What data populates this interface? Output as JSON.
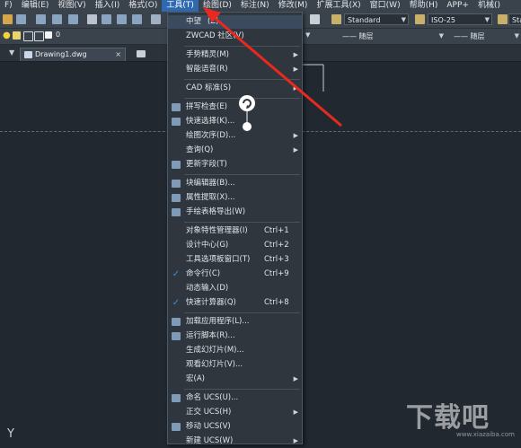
{
  "menubar": [
    "F)",
    "编辑(E)",
    "视图(V)",
    "插入(I)",
    "格式(O)",
    "工具(T)",
    "绘图(D)",
    "标注(N)",
    "修改(M)",
    "扩展工具(X)",
    "窗口(W)",
    "帮助(H)",
    "APP+",
    "机械()"
  ],
  "toolbar": {
    "text_style": "Standard",
    "dim_style": "ISO-25",
    "dim_style_extra": "Sta",
    "layer": "0",
    "linetype1": "—— 随层",
    "linetype2": "—— 随层"
  },
  "tab": {
    "label": "Drawing1.dwg"
  },
  "menu": {
    "items": [
      {
        "label": "中望",
        "suffix": "(Z)",
        "icon": "none",
        "shortcut": "",
        "submenu": false
      },
      {
        "label": "ZWCAD 社区(V)",
        "icon": "none",
        "shortcut": "",
        "submenu": false
      },
      {
        "label": "手势精灵(M)",
        "icon": "none",
        "shortcut": "",
        "submenu": true
      },
      {
        "label": "智能语音(R)",
        "icon": "none",
        "shortcut": "",
        "submenu": true
      },
      {
        "label": "CAD 标准(S)",
        "icon": "none",
        "shortcut": "",
        "submenu": true
      },
      {
        "label": "拼写检查(E)",
        "icon": "spell-icon",
        "shortcut": "",
        "submenu": false
      },
      {
        "label": "快速选择(K)...",
        "icon": "quickselect-icon",
        "shortcut": "",
        "submenu": false
      },
      {
        "label": "绘图次序(D)...",
        "icon": "none",
        "shortcut": "",
        "submenu": true
      },
      {
        "label": "查询(Q)",
        "icon": "none",
        "shortcut": "",
        "submenu": true
      },
      {
        "label": "更新字段(T)",
        "icon": "update-field-icon",
        "shortcut": "",
        "submenu": false
      },
      {
        "label": "块编辑器(B)...",
        "icon": "block-editor-icon",
        "shortcut": "",
        "submenu": false
      },
      {
        "label": "属性提取(X)...",
        "icon": "attribute-icon",
        "shortcut": "",
        "submenu": false
      },
      {
        "label": "手绘表格导出(W)",
        "icon": "table-export-icon",
        "shortcut": "",
        "submenu": false
      },
      {
        "label": "对象特性管理器(I)",
        "icon": "none",
        "shortcut": "Ctrl+1",
        "submenu": false
      },
      {
        "label": "设计中心(G)",
        "icon": "none",
        "shortcut": "Ctrl+2",
        "submenu": false
      },
      {
        "label": "工具选项板窗口(T)",
        "icon": "none",
        "shortcut": "Ctrl+3",
        "submenu": false
      },
      {
        "label": "命令行(C)",
        "icon": "check-icon",
        "shortcut": "Ctrl+9",
        "submenu": false
      },
      {
        "label": "动态输入(D)",
        "icon": "none",
        "shortcut": "",
        "submenu": false
      },
      {
        "label": "快速计算器(Q)",
        "icon": "check-icon",
        "shortcut": "Ctrl+8",
        "submenu": false
      },
      {
        "label": "加载应用程序(L)...",
        "icon": "load-app-icon",
        "shortcut": "",
        "submenu": false
      },
      {
        "label": "运行脚本(R)...",
        "icon": "script-icon",
        "shortcut": "",
        "submenu": false
      },
      {
        "label": "生成幻灯片(M)...",
        "icon": "none",
        "shortcut": "",
        "submenu": false
      },
      {
        "label": "观看幻灯片(V)...",
        "icon": "none",
        "shortcut": "",
        "submenu": false
      },
      {
        "label": "宏(A)",
        "icon": "none",
        "shortcut": "",
        "submenu": true
      },
      {
        "label": "命名 UCS(U)...",
        "icon": "ucs-icon",
        "shortcut": "",
        "submenu": false
      },
      {
        "label": "正交 UCS(H)",
        "icon": "none",
        "shortcut": "",
        "submenu": true
      },
      {
        "label": "移动 UCS(V)",
        "icon": "move-ucs-icon",
        "shortcut": "",
        "submenu": false
      },
      {
        "label": "新建 UCS(W)",
        "icon": "none",
        "shortcut": "",
        "submenu": true
      }
    ]
  },
  "axis_label": "Y",
  "watermark": {
    "big": "下载吧",
    "small": "www.xiazaiba.com"
  },
  "colors": {
    "accent": "#2f6ab1",
    "arrow": "#e8291f",
    "check": "#3c8ce6"
  }
}
